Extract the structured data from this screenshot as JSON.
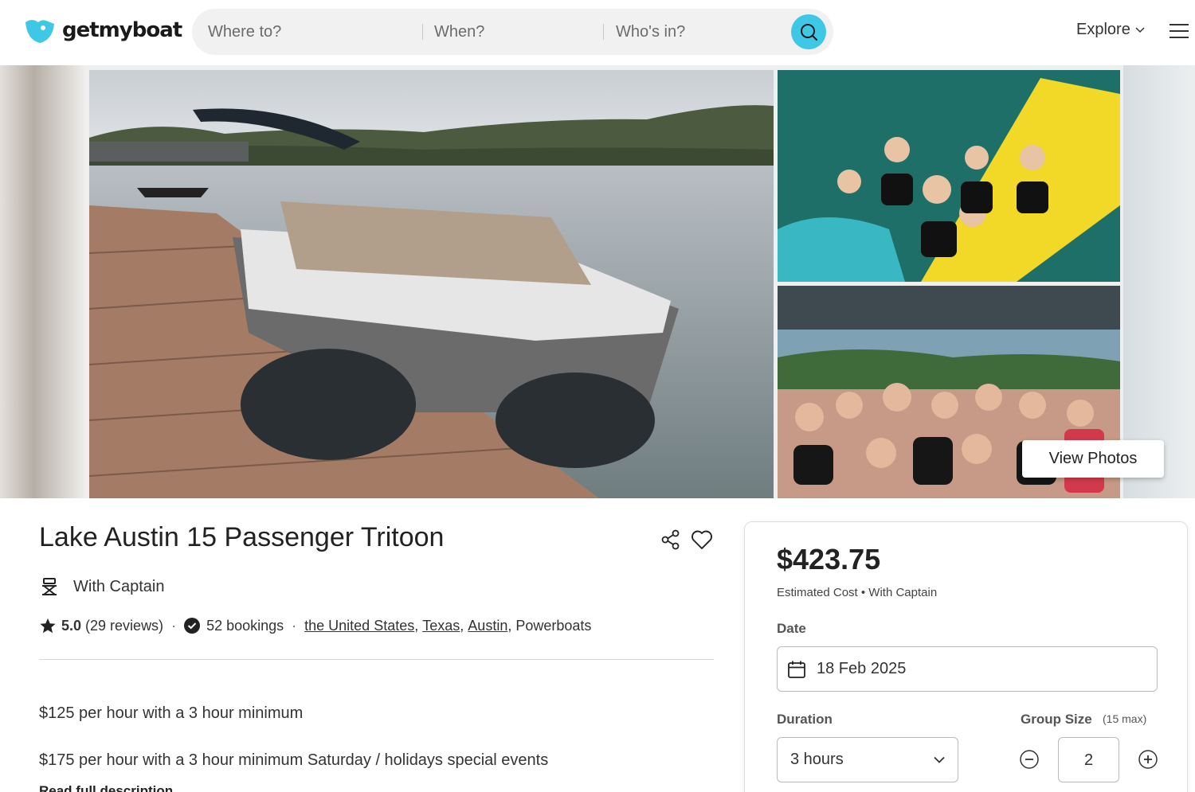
{
  "brand": {
    "name": "getmyboat",
    "accent": "#3ec8e5"
  },
  "search": {
    "where_placeholder": "Where to?",
    "when_placeholder": "When?",
    "who_placeholder": "Who's in?"
  },
  "nav": {
    "explore_label": "Explore"
  },
  "gallery": {
    "view_photos_label": "View Photos"
  },
  "listing": {
    "title": "Lake Austin 15 Passenger Tritoon",
    "captain_label": "With Captain",
    "rating": "5.0",
    "reviews": "(29 reviews)",
    "bookings": "52 bookings",
    "breadcrumbs": [
      "the United States",
      "Texas",
      "Austin"
    ],
    "category": "Powerboats",
    "description": [
      "$125 per hour with a 3 hour minimum",
      "$175 per hour with a 3 hour minimum Saturday / holidays special events"
    ],
    "read_more": "Read full description"
  },
  "booking": {
    "price": "$423.75",
    "estimate_note": "Estimated Cost • With Captain",
    "date_label": "Date",
    "date_value": "18 Feb 2025",
    "duration_label": "Duration",
    "duration_value": "3 hours",
    "group_label": "Group Size",
    "group_max": "(15 max)",
    "group_value": "2"
  }
}
